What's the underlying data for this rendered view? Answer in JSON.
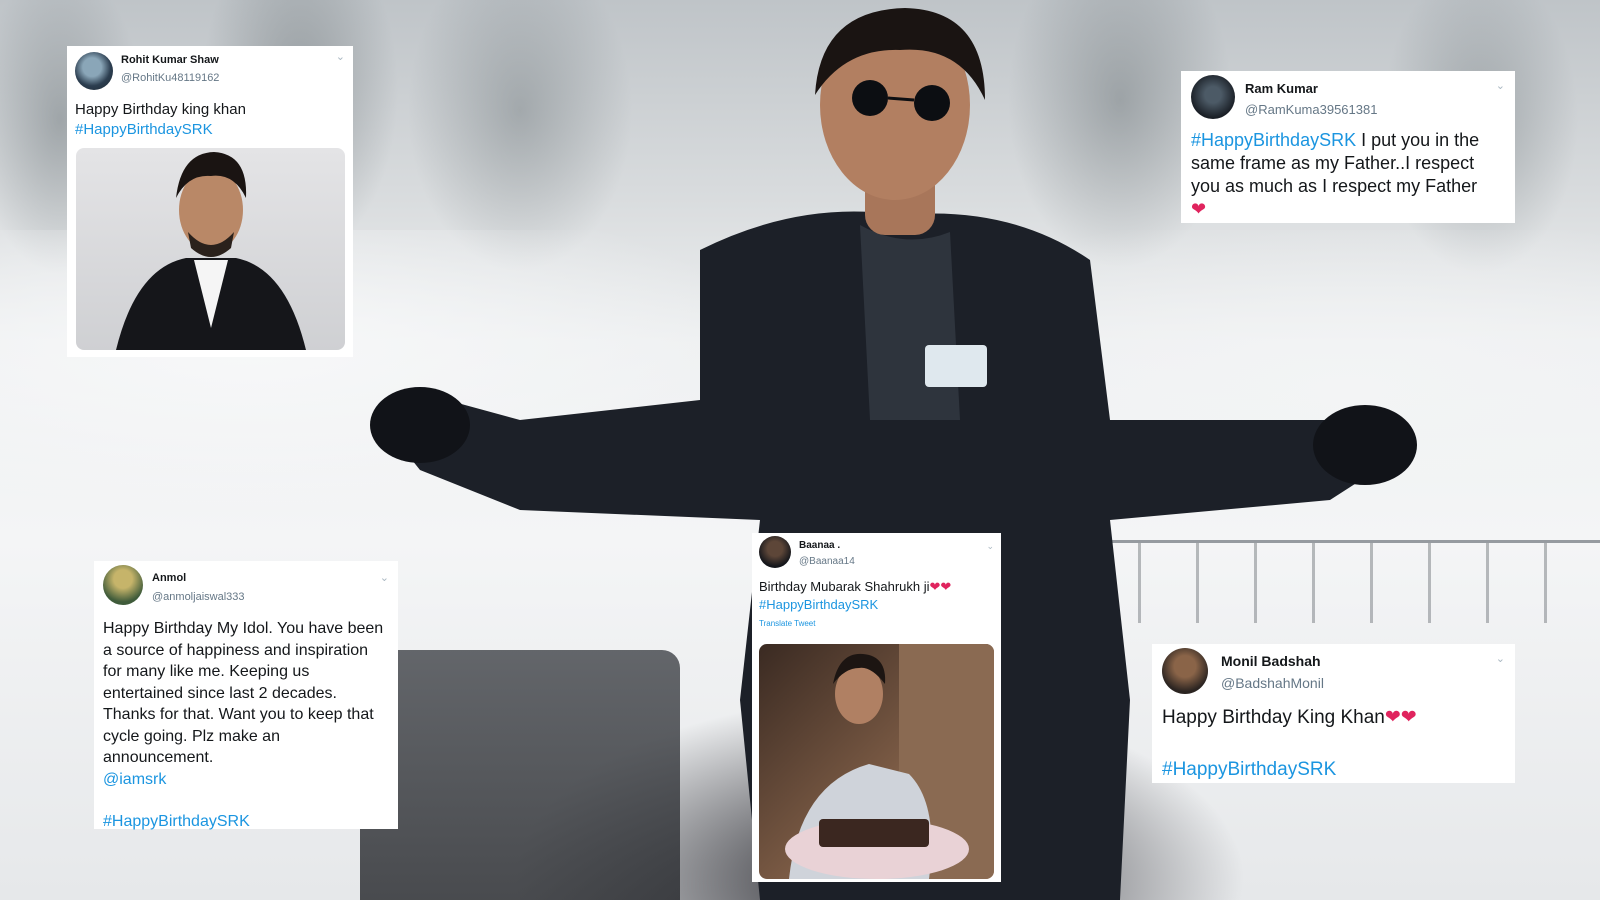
{
  "tweets": {
    "rohit": {
      "name": "Rohit Kumar Shaw",
      "handle": "@RohitKu48119162",
      "text": "Happy Birthday king khan",
      "hashtag": "#HappyBirthdaySRK"
    },
    "ram": {
      "name": "Ram Kumar",
      "handle": "@RamKuma39561381",
      "hashtag": "#HappyBirthdaySRK",
      "text": " I put you in the same frame as my Father..I respect you as much as I respect my Father",
      "emoji": "❤"
    },
    "anmol": {
      "name": "Anmol",
      "handle": "@anmoljaiswal333",
      "text": "Happy Birthday My Idol. You have been a source of happiness and inspiration for many like me. Keeping us entertained since last 2 decades. Thanks for that. Want you to keep that cycle going. Plz make an announcement.",
      "mention": "@iamsrk",
      "hashtag": "#HappyBirthdaySRK"
    },
    "baanaa": {
      "name": "Baanaa .",
      "handle": "@Baanaa14",
      "text": "Birthday Mubarak Shahrukh ji",
      "emoji": "❤❤",
      "hashtag": "#HappyBirthdaySRK",
      "translate": "Translate Tweet"
    },
    "monil": {
      "name": "Monil Badshah",
      "handle": "@BadshahMonil",
      "text": "Happy Birthday King Khan",
      "emoji": "❤❤",
      "hashtag": "#HappyBirthdaySRK"
    }
  },
  "icons": {
    "dropdown": "chevron-down-icon",
    "avatar": "avatar"
  },
  "colors": {
    "hashtag": "#1b95e0",
    "heart": "#e0245e",
    "handle": "#657786"
  }
}
